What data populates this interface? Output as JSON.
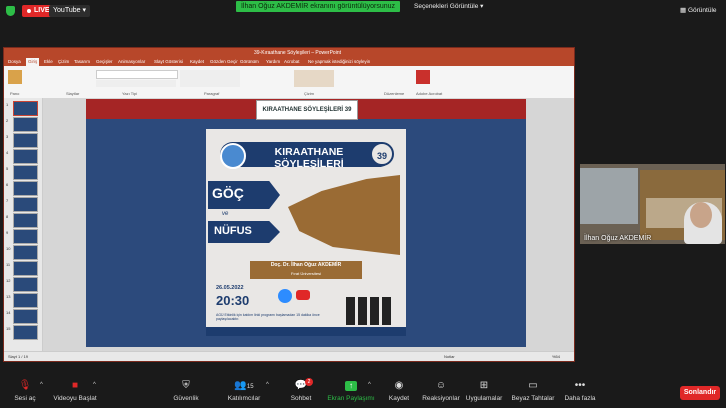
{
  "topbar": {
    "live_label": "LIVE",
    "youtube_label": "YouTube",
    "share_banner": "İlhan Oğuz AKDEMİR ekranını görüntülüyorsunuz",
    "view_options": "Seçenekleri Görüntüle",
    "gallery_label": "Görüntüle"
  },
  "ppt": {
    "window_title": "39-Kıraathane Söyleşileri – PowerPoint",
    "tabs": [
      "Dosya",
      "Giriş",
      "Ekle",
      "Çizim",
      "Tasarım",
      "Geçişler",
      "Animasyonlar",
      "Slayt Gösterisi",
      "Kaydet",
      "Gözden Geçir",
      "Görünüm",
      "Yardım",
      "Acrobat",
      "Ne yapmak istediğinizi söyleyin"
    ],
    "ribbon_groups": [
      "Pano",
      "Slaytlar",
      "Yazı Tipi",
      "Paragraf",
      "Çizim",
      "Düzenleme",
      "Adobe Acrobat"
    ],
    "status_left": "Slayt 1 / 19",
    "status_notes": "Notlar",
    "zoom": "%54"
  },
  "slide": {
    "header_logo_text": "KIRAATHANE SÖYLEŞİLERİ",
    "header_number": "39"
  },
  "poster": {
    "title": "KIRAATHANE SÖYLEŞİLERİ",
    "number": "39",
    "word1": "GÖÇ",
    "connector": "ve",
    "word2": "NÜFUS",
    "speaker": "Doç. Dr. İlhan Oğuz AKDEMİR",
    "university": "Fırat Üniversitesi",
    "date": "26.05.2022",
    "time": "20:30",
    "note": "AGÜ Etkinlik için katılım linki programı başlamadan 15 dakika önce paylaşılacaktır."
  },
  "cam": {
    "participant_name": "İlhan Oğuz AKDEMİR"
  },
  "toolbar": {
    "audio_label": "Sesi aç",
    "video_label": "Videoyu Başlat",
    "security_label": "Güvenlik",
    "participants_label": "Katılımcılar",
    "participants_count": "15",
    "chat_label": "Sohbet",
    "chat_badge": "2",
    "share_label": "Ekran Paylaşımı",
    "record_label": "Kaydet",
    "reactions_label": "Reaksiyonlar",
    "apps_label": "Uygulamalar",
    "whiteboard_label": "Beyaz Tahtalar",
    "more_label": "Daha fazla",
    "end_label": "Sonlandır"
  },
  "colors": {
    "live_red": "#e02828",
    "share_green": "#2dbd47",
    "ppt_brand": "#b7472a",
    "poster_navy": "#1d3c6e",
    "poster_brown": "#9a6b34"
  }
}
